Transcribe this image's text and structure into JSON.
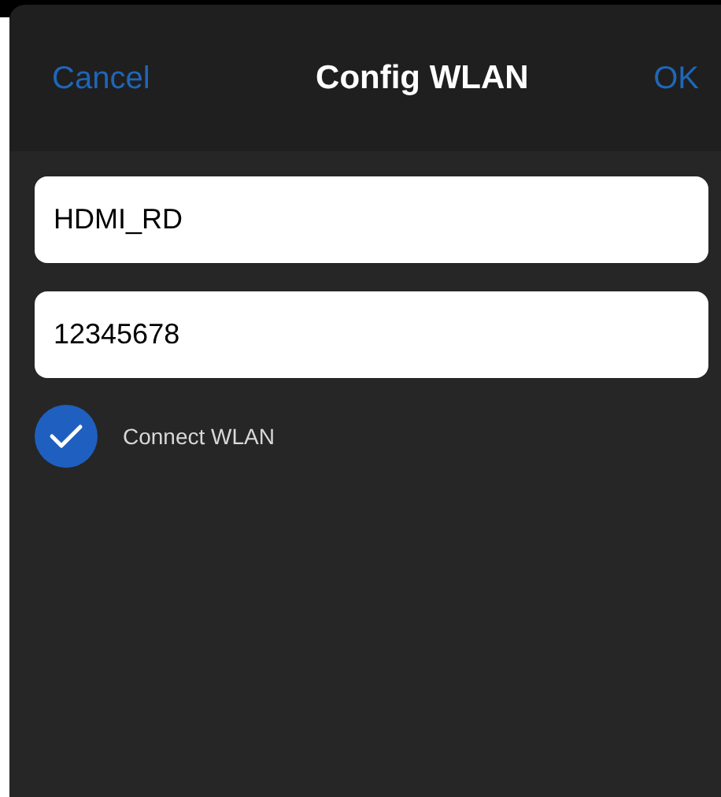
{
  "header": {
    "cancel": "Cancel",
    "title": "Config WLAN",
    "ok": "OK"
  },
  "fields": [
    {
      "value": "HDMI_RD"
    },
    {
      "value": "12345678"
    }
  ],
  "connect": {
    "label": "Connect WLAN",
    "checked": true
  }
}
